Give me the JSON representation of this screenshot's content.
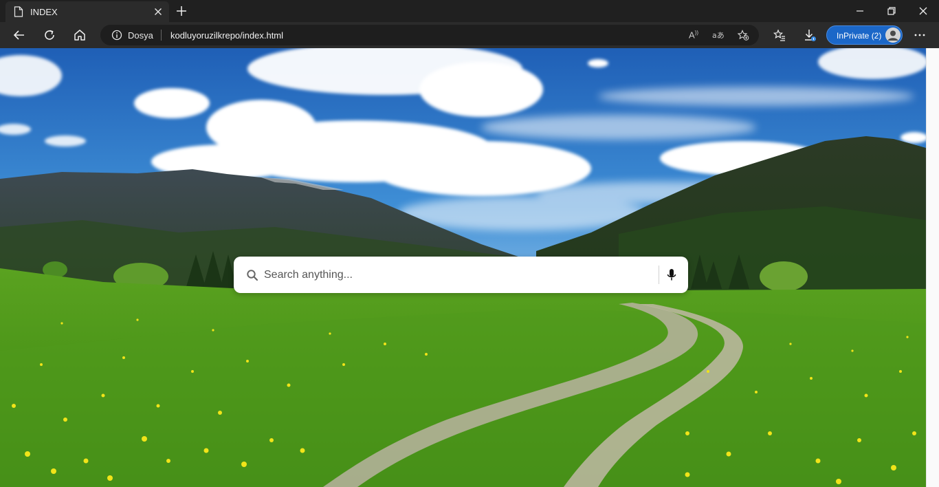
{
  "tab": {
    "title": "INDEX"
  },
  "address_bar": {
    "site_label": "Dosya",
    "url": "kodluyoruzilkrepo/index.html"
  },
  "profile": {
    "label": "InPrivate (2)"
  },
  "search": {
    "placeholder": "Search anything..."
  },
  "colors": {
    "accent": "#1b67c8",
    "chrome_dark": "#202020",
    "toolbar": "#2b2b2b"
  },
  "icons": {
    "page": "page-icon",
    "close_tab": "close-icon",
    "new_tab": "plus-icon",
    "back": "back-arrow-icon",
    "refresh": "refresh-icon",
    "home": "home-icon",
    "info": "info-icon",
    "read_aloud": "read-aloud-icon",
    "translate": "translate-icon",
    "add_favorite": "star-add-icon",
    "favorites": "favorites-icon",
    "downloads": "download-icon",
    "more": "more-icon",
    "search": "search-icon",
    "microphone": "microphone-icon"
  }
}
